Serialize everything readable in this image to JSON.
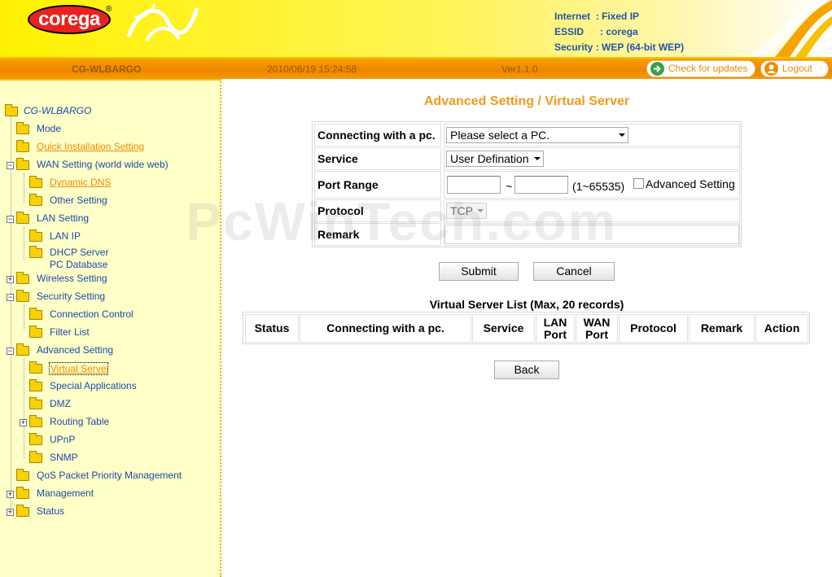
{
  "header": {
    "logo_text": "corega",
    "logo_mark": "®",
    "info": [
      {
        "key": "Internet",
        "value": ": Fixed IP"
      },
      {
        "key": "ESSID",
        "value": ": corega"
      },
      {
        "key": "Security",
        "value": ": WEP (64-bit WEP)"
      }
    ]
  },
  "statusbar": {
    "model": "CG-WLBARGO",
    "datetime": "2010/06/19 15:24:58",
    "firmware": "Ver1.1.0",
    "check_updates": "Check for updates",
    "logout": "Logout"
  },
  "sidebar": {
    "items": [
      {
        "label": "CG-WLBARGO"
      },
      {
        "label": "Mode"
      },
      {
        "label": "Quick Installation Setting"
      },
      {
        "label": "WAN Setting (world wide web)"
      },
      {
        "label": "Dynamic DNS"
      },
      {
        "label": "Other Setting"
      },
      {
        "label": "LAN Setting"
      },
      {
        "label": "LAN IP"
      },
      {
        "label": "DHCP Server"
      },
      {
        "label": "PC Database"
      },
      {
        "label": "Wireless Setting"
      },
      {
        "label": "Security Setting"
      },
      {
        "label": "Connection Control"
      },
      {
        "label": "Filter List"
      },
      {
        "label": "Advanced Setting"
      },
      {
        "label": "Virtual Server"
      },
      {
        "label": "Special Applications"
      },
      {
        "label": "DMZ"
      },
      {
        "label": "Routing Table"
      },
      {
        "label": "UPnP"
      },
      {
        "label": "SNMP"
      },
      {
        "label": "QoS Packet Priority Management"
      },
      {
        "label": "Management"
      },
      {
        "label": "Status"
      }
    ]
  },
  "main": {
    "title": "Advanced Setting / Virtual Server",
    "form": {
      "pc_label": "Connecting with a pc.",
      "pc_select": "Please select a PC.",
      "service_label": "Service",
      "service_select": "User Defination",
      "port_label": "Port Range",
      "port_from": "",
      "port_to": "",
      "port_sep": "~",
      "port_hint": "(1~65535)",
      "advanced_label": "Advanced Setting",
      "protocol_label": "Protocol",
      "protocol_select": "TCP",
      "remark_label": "Remark",
      "remark_value": ""
    },
    "submit": "Submit",
    "cancel": "Cancel",
    "list_caption": "Virtual Server List (Max, 20 records)",
    "columns": [
      "Status",
      "Connecting with a pc.",
      "Service",
      "LAN\nPort",
      "WAN\nPort",
      "Protocol",
      "Remark",
      "Action"
    ],
    "back": "Back"
  },
  "watermark": "PcWinTech.com",
  "colors": {
    "accent_orange": "#f39a1b",
    "link_blue": "#1a4aa8",
    "header_yellow": "#fff200",
    "sidebar_bg": "#ffffc8"
  }
}
